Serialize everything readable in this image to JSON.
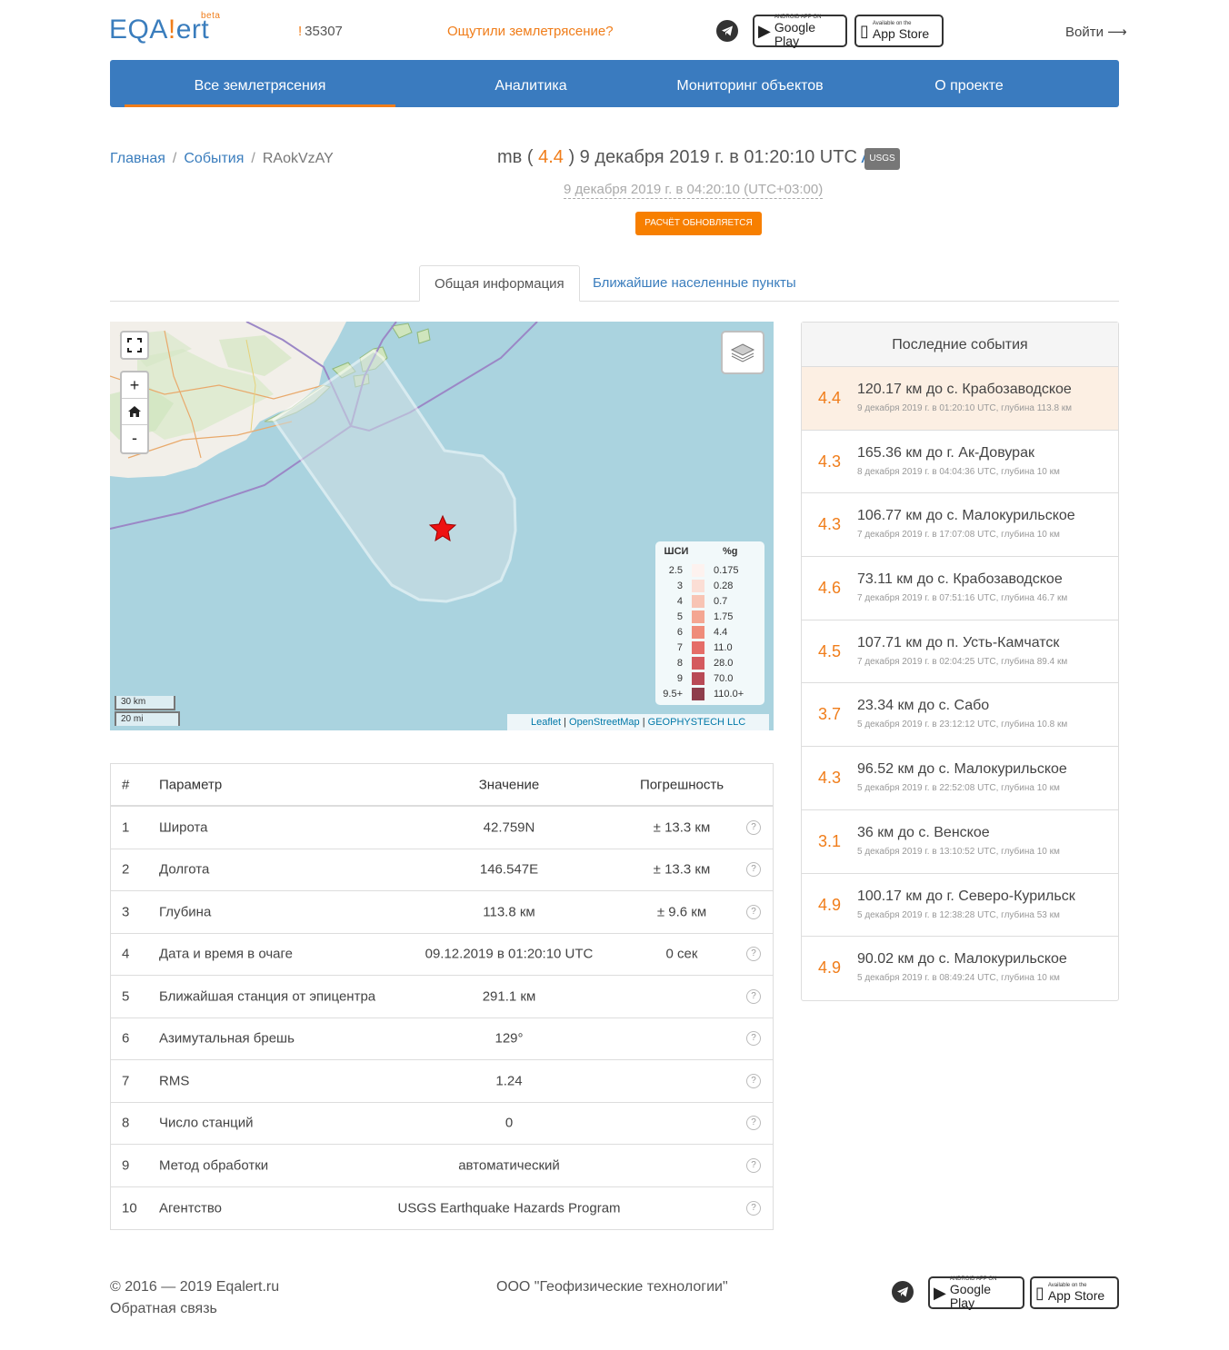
{
  "header": {
    "logo_pre": "EQA",
    "logo_bang": "!",
    "logo_post": "ert",
    "logo_beta": "beta",
    "counter_bang": "!",
    "counter_value": "35307",
    "felt_link": "Ощутили землетрясение?",
    "google_play_small": "ANDROID APP ON",
    "google_play_big": "Google Play",
    "app_store_small": "Available on the",
    "app_store_big": "App Store",
    "login": "Войти",
    "login_arrow": "⟶"
  },
  "nav": {
    "items": [
      {
        "label": "Все землетрясения"
      },
      {
        "label": "Аналитика"
      },
      {
        "label": "Мониторинг объектов"
      },
      {
        "label": "О проекте"
      }
    ]
  },
  "breadcrumb": {
    "home": "Главная",
    "events": "События",
    "current": "RAokVzAY",
    "sep": "/"
  },
  "event": {
    "mag_type": "mв",
    "mag": "4.4",
    "datetime_utc": "9 декабря 2019 г. в 01:20:10 UTC",
    "class": "A",
    "agency_badge": "USGS",
    "local_time": "9 декабря 2019 г. в 04:20:10 (UTC+03:00)",
    "status": "РАСЧЁТ ОБНОВЛЯЕТСЯ"
  },
  "tabs": {
    "general": "Общая информация",
    "nearest": "Ближайшие населенные пункты"
  },
  "map": {
    "legend_h1": "ШСИ",
    "legend_h2": "%g",
    "legend": [
      {
        "shsi": "2.5",
        "g": "0.175",
        "color": "#fdf2ef"
      },
      {
        "shsi": "3",
        "g": "0.28",
        "color": "#fbded5"
      },
      {
        "shsi": "4",
        "g": "0.7",
        "color": "#f8c4b4"
      },
      {
        "shsi": "5",
        "g": "1.75",
        "color": "#f4a692"
      },
      {
        "shsi": "6",
        "g": "4.4",
        "color": "#ef8c7a"
      },
      {
        "shsi": "7",
        "g": "11.0",
        "color": "#e56d68"
      },
      {
        "shsi": "8",
        "g": "28.0",
        "color": "#d45a5f"
      },
      {
        "shsi": "9",
        "g": "70.0",
        "color": "#b94a56"
      },
      {
        "shsi": "9.5+",
        "g": "110.0+",
        "color": "#8f3e4c"
      }
    ],
    "scale_km": "30 km",
    "scale_mi": "20 mi",
    "attr_leaflet": "Leaflet",
    "attr_sep": "|",
    "attr_osm": "OpenStreetMap",
    "attr_geo": "GEOPHYSTECH LLC",
    "zoom_in": "+",
    "zoom_out": "-"
  },
  "params": {
    "headers": {
      "num": "#",
      "param": "Параметр",
      "value": "Значение",
      "error": "Погрешность"
    },
    "rows": [
      {
        "n": "1",
        "p": "Широта",
        "v": "42.759N",
        "e": "± 13.3 км"
      },
      {
        "n": "2",
        "p": "Долгота",
        "v": "146.547E",
        "e": "± 13.3 км"
      },
      {
        "n": "3",
        "p": "Глубина",
        "v": "113.8 км",
        "e": "± 9.6 км"
      },
      {
        "n": "4",
        "p": "Дата и время в очаге",
        "v": "09.12.2019 в 01:20:10 UTC",
        "e": "0 сек"
      },
      {
        "n": "5",
        "p": "Ближайшая станция от эпицентра",
        "v": "291.1 км",
        "e": ""
      },
      {
        "n": "6",
        "p": "Азимутальная брешь",
        "v": "129°",
        "e": ""
      },
      {
        "n": "7",
        "p": "RMS",
        "v": "1.24",
        "e": ""
      },
      {
        "n": "8",
        "p": "Число станций",
        "v": "0",
        "e": ""
      },
      {
        "n": "9",
        "p": "Метод обработки",
        "v": "автоматический",
        "e": ""
      },
      {
        "n": "10",
        "p": "Агентство",
        "v": "USGS Earthquake Hazards Program",
        "e": ""
      }
    ],
    "help": "?"
  },
  "recent": {
    "title": "Последние события",
    "items": [
      {
        "mag": "4.4",
        "title": "120.17 км до с. Крабозаводское",
        "sub": "9 декабря 2019 г. в 01:20:10 UTC, глубина 113.8 км"
      },
      {
        "mag": "4.3",
        "title": "165.36 км до г. Ак-Довурак",
        "sub": "8 декабря 2019 г. в 04:04:36 UTC, глубина 10 км"
      },
      {
        "mag": "4.3",
        "title": "106.77 км до с. Малокурильское",
        "sub": "7 декабря 2019 г. в 17:07:08 UTC, глубина 10 км"
      },
      {
        "mag": "4.6",
        "title": "73.11 км до с. Крабозаводское",
        "sub": "7 декабря 2019 г. в 07:51:16 UTC, глубина 46.7 км"
      },
      {
        "mag": "4.5",
        "title": "107.71 км до п. Усть-Камчатск",
        "sub": "7 декабря 2019 г. в 02:04:25 UTC, глубина 89.4 км"
      },
      {
        "mag": "3.7",
        "title": "23.34 км до с. Сабо",
        "sub": "5 декабря 2019 г. в 23:12:12 UTC, глубина 10.8 км"
      },
      {
        "mag": "4.3",
        "title": "96.52 км до с. Малокурильское",
        "sub": "5 декабря 2019 г. в 22:52:08 UTC, глубина 10 км"
      },
      {
        "mag": "3.1",
        "title": "36 км до с. Венское",
        "sub": "5 декабря 2019 г. в 13:10:52 UTC, глубина 10 км"
      },
      {
        "mag": "4.9",
        "title": "100.17 км до г. Северо-Курильск",
        "sub": "5 декабря 2019 г. в 12:38:28 UTC, глубина 53 км"
      },
      {
        "mag": "4.9",
        "title": "90.02 км до с. Малокурильское",
        "sub": "5 декабря 2019 г. в 08:49:24 UTC, глубина 10 км"
      }
    ]
  },
  "footer": {
    "copyright": "© 2016 — 2019 Eqalert.ru",
    "feedback": "Обратная связь",
    "company": "ООО \"Геофизические технологии\""
  },
  "colors": {
    "brand_blue": "#3a7bbf",
    "accent_orange": "#f07d1a",
    "sea": "#aad3df"
  }
}
